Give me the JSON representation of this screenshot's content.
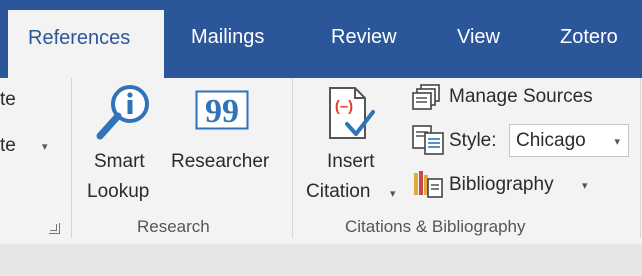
{
  "tabs": {
    "references": "References",
    "mailings": "Mailings",
    "review": "Review",
    "view": "View",
    "zotero": "Zotero"
  },
  "left_partial": {
    "line1": "te",
    "line2": "te",
    "caret": "▾"
  },
  "research": {
    "smart_lookup_line1": "Smart",
    "smart_lookup_line2": "Lookup",
    "researcher": "Researcher",
    "group_label": "Research"
  },
  "citations": {
    "insert_line1": "Insert",
    "insert_line2": "Citation",
    "insert_caret": "▾",
    "manage_sources": "Manage Sources",
    "style_label": "Style:",
    "style_value": "Chicago",
    "style_caret": "▾",
    "bibliography": "Bibliography",
    "bibliography_caret": "▾",
    "group_label": "Citations & Bibliography"
  },
  "icons": {
    "smart_lookup": "magnifier-info-icon",
    "researcher": "quote-icon",
    "insert_citation": "insert-citation-icon",
    "manage_sources": "manage-sources-icon",
    "style": "style-icon",
    "bibliography": "bibliography-icon",
    "launcher": "dialog-launcher-icon"
  },
  "colors": {
    "ribbon_blue": "#2b579a",
    "accent_blue": "#2f73b8",
    "citation_red": "#d9402f",
    "ribbon_bg": "#f3f3f3"
  }
}
